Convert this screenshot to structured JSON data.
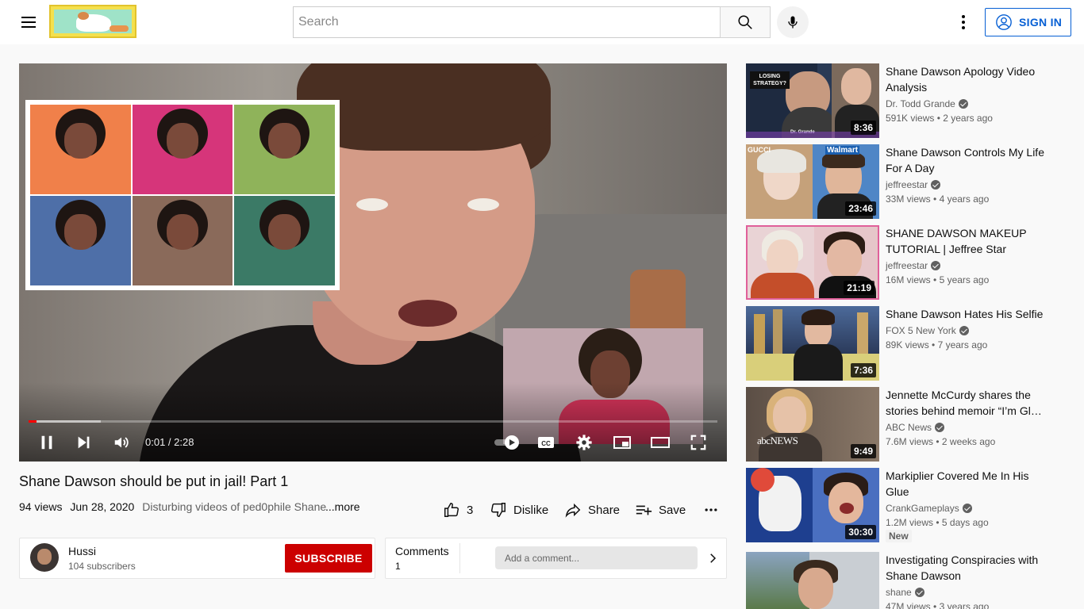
{
  "header": {
    "search_placeholder": "Search",
    "signin_label": "SIGN IN"
  },
  "player": {
    "time": "0:01 / 2:28",
    "progress_played_fraction": 0.011,
    "progress_buffered_fraction": 0.105
  },
  "video": {
    "title": "Shane Dawson should be put in jail! Part 1",
    "views": "94 views",
    "date": "Jun 28, 2020",
    "description": "Disturbing videos of ped0phile Shane",
    "more_label": "...more",
    "likes": "3",
    "dislike_label": "Dislike",
    "share_label": "Share",
    "save_label": "Save"
  },
  "channel": {
    "name": "Hussi",
    "subscribers": "104 subscribers",
    "subscribe_label": "SUBSCRIBE"
  },
  "comments": {
    "label": "Comments",
    "count": "1",
    "placeholder": "Add a comment..."
  },
  "recommendations": [
    {
      "title": "Shane Dawson Apology Video Analysis",
      "channel": "Dr. Todd Grande",
      "verified": true,
      "views": "591K views",
      "age": "2 years ago",
      "duration": "8:36",
      "new": ""
    },
    {
      "title": "Shane Dawson Controls My Life For A Day",
      "channel": "jeffreestar",
      "verified": true,
      "views": "33M views",
      "age": "4 years ago",
      "duration": "23:46",
      "new": ""
    },
    {
      "title": "SHANE DAWSON MAKEUP TUTORIAL | Jeffree Star",
      "channel": "jeffreestar",
      "verified": true,
      "views": "16M views",
      "age": "5 years ago",
      "duration": "21:19",
      "new": ""
    },
    {
      "title": "Shane Dawson Hates His Selfie",
      "channel": "FOX 5 New York",
      "verified": true,
      "views": "89K views",
      "age": "7 years ago",
      "duration": "7:36",
      "new": ""
    },
    {
      "title": "Jennette McCurdy shares the stories behind memoir “I’m Gl…",
      "channel": "ABC News",
      "verified": true,
      "views": "7.6M views",
      "age": "2 weeks ago",
      "duration": "9:49",
      "new": ""
    },
    {
      "title": "Markiplier Covered Me In His Glue",
      "channel": "CrankGameplays",
      "verified": true,
      "views": "1.2M views",
      "age": "5 days ago",
      "duration": "30:30",
      "new": "New"
    },
    {
      "title": "Investigating Conspiracies with Shane Dawson",
      "channel": "shane",
      "verified": true,
      "views": "47M views",
      "age": "3 years ago",
      "duration": "",
      "new": ""
    }
  ],
  "thumb_texts": {
    "t0_badge": "LOSING STRATEGY?",
    "t0_caption": "Dr. Grande",
    "t1_gucci": "GUCCI",
    "t1_walmart": "Walmart",
    "t4_logo": "abcNEWS"
  },
  "colors": {
    "subscribe": "#cc0000",
    "signin": "#065fd4",
    "progress": "#ff0000"
  }
}
